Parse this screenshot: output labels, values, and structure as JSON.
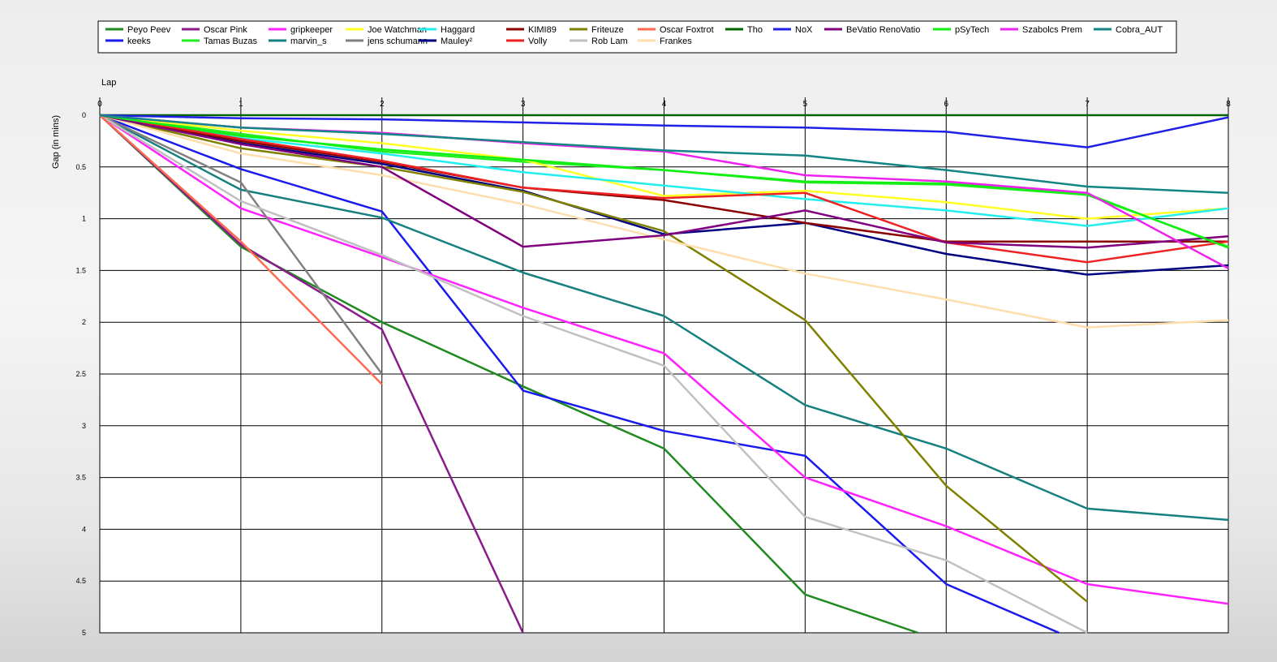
{
  "chart_data": {
    "type": "line",
    "x_axis_label": "Lap",
    "y_axis_label": "Gap (in mins)",
    "x_ticks": [
      0,
      1,
      2,
      3,
      4,
      5,
      6,
      7,
      8
    ],
    "y_ticks": [
      "0",
      "0.5",
      "1",
      "1.5",
      "2",
      "2.5",
      "3",
      "3.5",
      "4",
      "4.5",
      "5"
    ],
    "xlim": [
      0,
      8
    ],
    "ylim": [
      0,
      5
    ],
    "y_inverted": true,
    "grid": true,
    "legend_position": "top",
    "series": [
      {
        "name": "Peyo Peev",
        "color": "#1f8a1f",
        "points": [
          [
            0,
            0
          ],
          [
            1,
            1.27
          ],
          [
            2,
            2.0
          ],
          [
            3,
            2.62
          ],
          [
            4,
            3.22
          ],
          [
            5,
            4.63
          ],
          [
            5.8,
            5.0
          ]
        ]
      },
      {
        "name": "keeks",
        "color": "#1a1aee",
        "points": [
          [
            0,
            0
          ],
          [
            1,
            0.52
          ],
          [
            2,
            0.93
          ],
          [
            3,
            2.66
          ],
          [
            4,
            3.05
          ],
          [
            5,
            3.29
          ],
          [
            6,
            4.53
          ],
          [
            6.8,
            5.0
          ]
        ]
      },
      {
        "name": "Oscar Pink",
        "color": "#8b1a8b",
        "points": [
          [
            0,
            0
          ],
          [
            1,
            1.25
          ],
          [
            2,
            2.07
          ],
          [
            3,
            5.0
          ]
        ]
      },
      {
        "name": "Tamas Buzas",
        "color": "#22ee22",
        "points": [
          [
            0,
            0
          ],
          [
            1,
            0.18
          ],
          [
            2,
            0.35
          ],
          [
            3,
            0.45
          ],
          [
            4,
            0.53
          ],
          [
            5,
            0.65
          ],
          [
            6,
            0.67
          ],
          [
            7,
            0.77
          ],
          [
            8,
            1.27
          ]
        ]
      },
      {
        "name": "gripkeeper",
        "color": "#ff22ff",
        "points": [
          [
            0,
            0
          ],
          [
            1,
            0.9
          ],
          [
            2,
            1.37
          ],
          [
            3,
            1.86
          ],
          [
            4,
            2.3
          ],
          [
            5,
            3.5
          ],
          [
            6,
            3.97
          ],
          [
            7,
            4.53
          ],
          [
            8,
            4.72
          ]
        ]
      },
      {
        "name": "marvin_s",
        "color": "#168080",
        "points": [
          [
            0,
            0
          ],
          [
            1,
            0.72
          ],
          [
            2,
            0.99
          ],
          [
            3,
            1.52
          ],
          [
            4,
            1.94
          ],
          [
            5,
            2.8
          ],
          [
            6,
            3.22
          ],
          [
            7,
            3.8
          ],
          [
            8,
            3.91
          ]
        ]
      },
      {
        "name": "Joe Watchman",
        "color": "#ffff22",
        "points": [
          [
            0,
            0
          ],
          [
            1,
            0.15
          ],
          [
            2,
            0.27
          ],
          [
            3,
            0.43
          ],
          [
            4,
            0.78
          ],
          [
            5,
            0.73
          ],
          [
            6,
            0.84
          ],
          [
            7,
            1.0
          ],
          [
            8,
            0.9
          ]
        ]
      },
      {
        "name": "jens schumann",
        "color": "#808080",
        "points": [
          [
            0,
            0
          ],
          [
            1,
            0.65
          ],
          [
            2,
            2.5
          ]
        ]
      },
      {
        "name": "Haggard",
        "color": "#22eeee",
        "points": [
          [
            0,
            0
          ],
          [
            1,
            0.22
          ],
          [
            2,
            0.37
          ],
          [
            3,
            0.55
          ],
          [
            4,
            0.68
          ],
          [
            5,
            0.81
          ],
          [
            6,
            0.92
          ],
          [
            7,
            1.07
          ],
          [
            8,
            0.9
          ]
        ]
      },
      {
        "name": "Mauley²",
        "color": "#000080",
        "points": [
          [
            0,
            0
          ],
          [
            1,
            0.27
          ],
          [
            2,
            0.47
          ],
          [
            3,
            0.73
          ],
          [
            4,
            1.15
          ],
          [
            5,
            1.04
          ],
          [
            6,
            1.34
          ],
          [
            7,
            1.54
          ],
          [
            8,
            1.45
          ]
        ]
      },
      {
        "name": "KIMI89",
        "color": "#8b0000",
        "points": [
          [
            0,
            0
          ],
          [
            1,
            0.25
          ],
          [
            2,
            0.45
          ],
          [
            3,
            0.7
          ],
          [
            4,
            0.82
          ],
          [
            5,
            1.04
          ],
          [
            6,
            1.22
          ],
          [
            7,
            1.22
          ],
          [
            8,
            1.22
          ]
        ]
      },
      {
        "name": "Volly",
        "color": "#ee2222",
        "points": [
          [
            0,
            0
          ],
          [
            1,
            0.23
          ],
          [
            2,
            0.44
          ],
          [
            3,
            0.7
          ],
          [
            4,
            0.8
          ],
          [
            5,
            0.75
          ],
          [
            6,
            1.23
          ],
          [
            7,
            1.42
          ],
          [
            8,
            1.22
          ]
        ]
      },
      {
        "name": "Friteuze",
        "color": "#808000",
        "points": [
          [
            0,
            0
          ],
          [
            1,
            0.32
          ],
          [
            2,
            0.5
          ],
          [
            3,
            0.74
          ],
          [
            4,
            1.12
          ],
          [
            5,
            1.98
          ],
          [
            6,
            3.58
          ],
          [
            7,
            4.7
          ]
        ]
      },
      {
        "name": "Rob Lam",
        "color": "#c0c0c0",
        "points": [
          [
            0,
            0
          ],
          [
            1,
            0.83
          ],
          [
            2,
            1.35
          ],
          [
            3,
            1.94
          ],
          [
            4,
            2.42
          ],
          [
            5,
            3.88
          ],
          [
            6,
            4.3
          ],
          [
            7,
            5.0
          ]
        ]
      },
      {
        "name": "Oscar Foxtrot",
        "color": "#ff6a50",
        "points": [
          [
            0,
            0
          ],
          [
            1,
            1.22
          ],
          [
            2,
            2.6
          ]
        ]
      },
      {
        "name": "Frankes",
        "color": "#ffdead",
        "points": [
          [
            0,
            0
          ],
          [
            1,
            0.37
          ],
          [
            2,
            0.58
          ],
          [
            3,
            0.86
          ],
          [
            4,
            1.2
          ],
          [
            5,
            1.53
          ],
          [
            6,
            1.78
          ],
          [
            7,
            2.05
          ],
          [
            8,
            1.98
          ]
        ]
      },
      {
        "name": "Tho",
        "color": "#006400",
        "points": [
          [
            0,
            0
          ],
          [
            1,
            0
          ],
          [
            2,
            0
          ],
          [
            3,
            0
          ],
          [
            4,
            0
          ],
          [
            5,
            0
          ],
          [
            6,
            0
          ],
          [
            7,
            0
          ],
          [
            8,
            0
          ]
        ]
      },
      {
        "name": "NoX",
        "color": "#2020e6",
        "points": [
          [
            0,
            0
          ],
          [
            1,
            0.03
          ],
          [
            2,
            0.04
          ],
          [
            3,
            0.07
          ],
          [
            4,
            0.1
          ],
          [
            5,
            0.12
          ],
          [
            6,
            0.16
          ],
          [
            7,
            0.31
          ],
          [
            8,
            0.02
          ]
        ]
      },
      {
        "name": "BeVatio RenoVatio",
        "color": "#800080",
        "points": [
          [
            0,
            0
          ],
          [
            1,
            0.28
          ],
          [
            2,
            0.5
          ],
          [
            3,
            1.27
          ],
          [
            4,
            1.16
          ],
          [
            5,
            0.92
          ],
          [
            6,
            1.23
          ],
          [
            7,
            1.28
          ],
          [
            8,
            1.17
          ]
        ]
      },
      {
        "name": "pSyTech",
        "color": "#11ee11",
        "points": [
          [
            0,
            0
          ],
          [
            1,
            0.2
          ],
          [
            2,
            0.33
          ],
          [
            3,
            0.43
          ],
          [
            4,
            0.53
          ],
          [
            5,
            0.64
          ],
          [
            6,
            0.66
          ],
          [
            7,
            0.76
          ],
          [
            8,
            1.28
          ]
        ]
      },
      {
        "name": "Szabolcs Prem",
        "color": "#ee22ee",
        "points": [
          [
            0,
            0
          ],
          [
            1,
            0.12
          ],
          [
            2,
            0.17
          ],
          [
            3,
            0.27
          ],
          [
            4,
            0.35
          ],
          [
            5,
            0.58
          ],
          [
            6,
            0.64
          ],
          [
            7,
            0.75
          ],
          [
            8,
            1.48
          ]
        ]
      },
      {
        "name": "Cobra_AUT",
        "color": "#148585",
        "points": [
          [
            0,
            0
          ],
          [
            1,
            0.12
          ],
          [
            2,
            0.18
          ],
          [
            3,
            0.26
          ],
          [
            4,
            0.34
          ],
          [
            5,
            0.39
          ],
          [
            6,
            0.53
          ],
          [
            7,
            0.69
          ],
          [
            8,
            0.75
          ]
        ]
      }
    ]
  }
}
